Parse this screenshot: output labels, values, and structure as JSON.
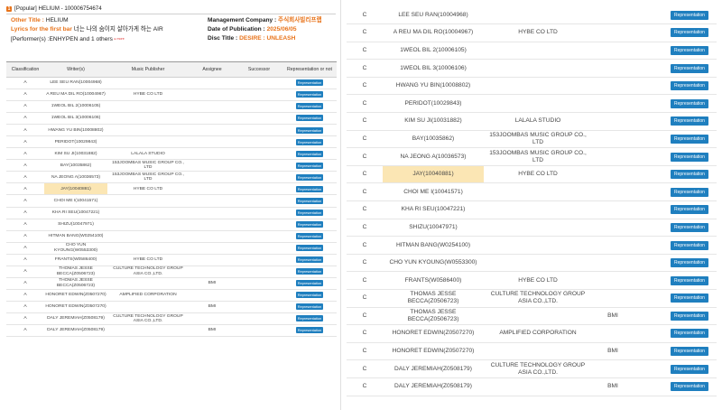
{
  "header": {
    "badge": "1",
    "title": "[Popular] HELIUM - 100006754674"
  },
  "meta": {
    "other_title_label": "Other Title : ",
    "other_title_value": "HELIUM",
    "lyrics_label": "Lyrics for the first bar",
    "lyrics_value": "너는 나의 숨이지 살아가게 하는 AIR",
    "performer_text": "[Performer(s) :ENHYPEN and 1 others",
    "more_label": "▸ more",
    "mgmt_label": "Management Company : ",
    "mgmt_value": "주식회사빌리프랩",
    "date_label": "Date of Publication : ",
    "date_value": "2025/06/05",
    "disc_label": "Disc Title : ",
    "disc_value": "DESIRE : UNLEASH"
  },
  "left_table": {
    "headers": [
      "Classification",
      "Writer(s)",
      "Music Publisher",
      "Assignee",
      "Successor",
      "Representation or not"
    ],
    "rows": [
      {
        "cls": "A",
        "writer": "LEE SEU RAN(10004968)",
        "publisher": "",
        "assignee": "",
        "successor": "",
        "rep": "Representation"
      },
      {
        "cls": "A",
        "writer": "A REU MA DIL RO(10004967)",
        "publisher": "HYBE CO LTD",
        "assignee": "",
        "successor": "",
        "rep": "Representation"
      },
      {
        "cls": "A",
        "writer": "1WEOL BIL 2(10006105)",
        "publisher": "",
        "assignee": "",
        "successor": "",
        "rep": "Representation"
      },
      {
        "cls": "A",
        "writer": "1WEOL BIL 3(10006106)",
        "publisher": "",
        "assignee": "",
        "successor": "",
        "rep": "Representation"
      },
      {
        "cls": "A",
        "writer": "HWANG YU BIN(10008802)",
        "publisher": "",
        "assignee": "",
        "successor": "",
        "rep": "Representation"
      },
      {
        "cls": "A",
        "writer": "PERIDOT(10029843)",
        "publisher": "",
        "assignee": "",
        "successor": "",
        "rep": "Representation"
      },
      {
        "cls": "A",
        "writer": "KIM SU JI(10031882)",
        "publisher": "LALALA STUDIO",
        "assignee": "",
        "successor": "",
        "rep": "Representation"
      },
      {
        "cls": "A",
        "writer": "BAY(10035862)",
        "publisher": "153JOOMBAS MUSIC GROUP CO., LTD",
        "assignee": "",
        "successor": "",
        "rep": "Representation"
      },
      {
        "cls": "A",
        "writer": "NA JEONG A(10036573)",
        "publisher": "153JOOMBAS MUSIC GROUP CO., LTD",
        "assignee": "",
        "successor": "",
        "rep": "Representation"
      },
      {
        "cls": "A",
        "writer": "JAY(10040881)",
        "publisher": "HYBE CO LTD",
        "assignee": "",
        "successor": "",
        "rep": "Representation",
        "highlight": true
      },
      {
        "cls": "A",
        "writer": "CHOI ME I(10041571)",
        "publisher": "",
        "assignee": "",
        "successor": "",
        "rep": "Representation"
      },
      {
        "cls": "A",
        "writer": "KHA RI SEU(10047221)",
        "publisher": "",
        "assignee": "",
        "successor": "",
        "rep": "Representation"
      },
      {
        "cls": "A",
        "writer": "SHIZU(10047971)",
        "publisher": "",
        "assignee": "",
        "successor": "",
        "rep": "Representation"
      },
      {
        "cls": "A",
        "writer": "HITMAN BANG(W0254100)",
        "publisher": "",
        "assignee": "",
        "successor": "",
        "rep": "Representation"
      },
      {
        "cls": "A",
        "writer": "CHO YUN KYOUNG(W0553300)",
        "publisher": "",
        "assignee": "",
        "successor": "",
        "rep": "Representation"
      },
      {
        "cls": "A",
        "writer": "FRANTS(W0586400)",
        "publisher": "HYBE CO LTD",
        "assignee": "",
        "successor": "",
        "rep": "Representation"
      },
      {
        "cls": "A",
        "writer": "THOMAS JESSE BECCA(Z0506723)",
        "publisher": "CULTURE TECHNOLOGY GROUP ASIA CO.,LTD.",
        "assignee": "",
        "successor": "",
        "rep": "Representation"
      },
      {
        "cls": "A",
        "writer": "THOMAS JESSE BECCA(Z0506723)",
        "publisher": "",
        "assignee": "BMI",
        "successor": "",
        "rep": "Representation"
      },
      {
        "cls": "A",
        "writer": "HONORET EDWIN(Z0507270)",
        "publisher": "AMPLIFIED CORPORATION",
        "assignee": "",
        "successor": "",
        "rep": "Representation"
      },
      {
        "cls": "A",
        "writer": "HONORET EDWIN(Z0507270)",
        "publisher": "",
        "assignee": "BMI",
        "successor": "",
        "rep": "Representation"
      },
      {
        "cls": "A",
        "writer": "DALY JEREMIAH(Z0508179)",
        "publisher": "CULTURE TECHNOLOGY GROUP ASIA CO.,LTD.",
        "assignee": "",
        "successor": "",
        "rep": "Representation"
      },
      {
        "cls": "A",
        "writer": "DALY JEREMIAH(Z0508179)",
        "publisher": "",
        "assignee": "BMI",
        "successor": "",
        "rep": "Representation"
      }
    ]
  },
  "right_table": {
    "rows": [
      {
        "cls": "C",
        "writer": "LEE SEU RAN(10004968)",
        "publisher": "",
        "assignee": "",
        "rep": "Representation"
      },
      {
        "cls": "C",
        "writer": "A REU MA DIL RO(10004967)",
        "publisher": "HYBE CO LTD",
        "assignee": "",
        "rep": "Representation"
      },
      {
        "cls": "C",
        "writer": "1WEOL BIL 2(10006105)",
        "publisher": "",
        "assignee": "",
        "rep": "Representation"
      },
      {
        "cls": "C",
        "writer": "1WEOL BIL 3(10006106)",
        "publisher": "",
        "assignee": "",
        "rep": "Representation"
      },
      {
        "cls": "C",
        "writer": "HWANG YU BIN(10008802)",
        "publisher": "",
        "assignee": "",
        "rep": "Representation"
      },
      {
        "cls": "C",
        "writer": "PERIDOT(10029843)",
        "publisher": "",
        "assignee": "",
        "rep": "Representation"
      },
      {
        "cls": "C",
        "writer": "KIM SU JI(10031882)",
        "publisher": "LALALA STUDIO",
        "assignee": "",
        "rep": "Representation"
      },
      {
        "cls": "C",
        "writer": "BAY(10035862)",
        "publisher": "153JOOMBAS MUSIC GROUP CO., LTD",
        "assignee": "",
        "rep": "Representation"
      },
      {
        "cls": "C",
        "writer": "NA JEONG A(10036573)",
        "publisher": "153JOOMBAS MUSIC GROUP CO., LTD",
        "assignee": "",
        "rep": "Representation"
      },
      {
        "cls": "C",
        "writer": "JAY(10040881)",
        "publisher": "HYBE CO LTD",
        "assignee": "",
        "rep": "Representation",
        "highlight": true
      },
      {
        "cls": "C",
        "writer": "CHOI ME I(10041571)",
        "publisher": "",
        "assignee": "",
        "rep": "Representation"
      },
      {
        "cls": "C",
        "writer": "KHA RI SEU(10047221)",
        "publisher": "",
        "assignee": "",
        "rep": "Representation"
      },
      {
        "cls": "C",
        "writer": "SHIZU(10047971)",
        "publisher": "",
        "assignee": "",
        "rep": "Representation"
      },
      {
        "cls": "C",
        "writer": "HITMAN BANG(W0254100)",
        "publisher": "",
        "assignee": "",
        "rep": "Representation"
      },
      {
        "cls": "C",
        "writer": "CHO YUN KYOUNG(W0553300)",
        "publisher": "",
        "assignee": "",
        "rep": "Representation"
      },
      {
        "cls": "C",
        "writer": "FRANTS(W0586400)",
        "publisher": "HYBE CO LTD",
        "assignee": "",
        "rep": "Representation"
      },
      {
        "cls": "C",
        "writer": "THOMAS JESSE BECCA(Z0506723)",
        "publisher": "CULTURE TECHNOLOGY GROUP ASIA CO.,LTD.",
        "assignee": "",
        "rep": "Representation"
      },
      {
        "cls": "C",
        "writer": "THOMAS JESSE BECCA(Z0506723)",
        "publisher": "",
        "assignee": "BMI",
        "rep": "Representation"
      },
      {
        "cls": "C",
        "writer": "HONORET EDWIN(Z0507270)",
        "publisher": "AMPLIFIED CORPORATION",
        "assignee": "",
        "rep": "Representation"
      },
      {
        "cls": "C",
        "writer": "HONORET EDWIN(Z0507270)",
        "publisher": "",
        "assignee": "BMI",
        "rep": "Representation"
      },
      {
        "cls": "C",
        "writer": "DALY JEREMIAH(Z0508179)",
        "publisher": "CULTURE TECHNOLOGY GROUP ASIA CO.,LTD.",
        "assignee": "",
        "rep": "Representation"
      },
      {
        "cls": "C",
        "writer": "DALY JEREMIAH(Z0508179)",
        "publisher": "",
        "assignee": "BMI",
        "rep": "Representation"
      }
    ]
  },
  "colors": {
    "accent": "#e8731a",
    "highlight": "#fbe6b4",
    "button": "#1f7fbf"
  }
}
